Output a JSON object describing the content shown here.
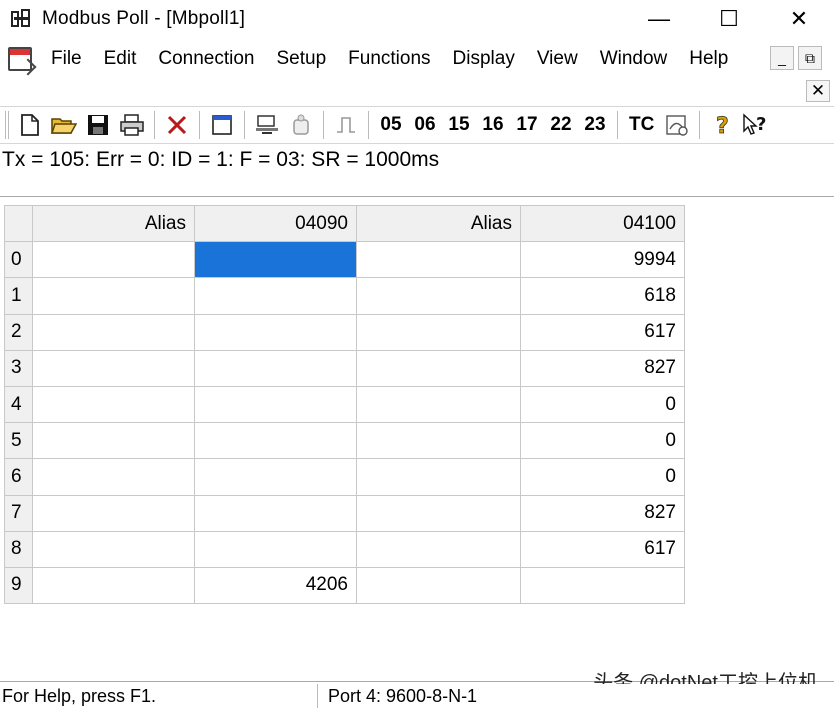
{
  "window": {
    "title": "Modbus Poll - [Mbpoll1]",
    "minimize": "—",
    "maximize": "☐",
    "close": "✕"
  },
  "menu": {
    "items": [
      "File",
      "Edit",
      "Connection",
      "Setup",
      "Functions",
      "Display",
      "View",
      "Window",
      "Help"
    ],
    "mdi_min": "_",
    "mdi_restore": "⧉",
    "mdi_close": "✕"
  },
  "toolbar": {
    "function_codes": [
      "05",
      "06",
      "15",
      "16",
      "17",
      "22",
      "23"
    ],
    "tc_label": "TC"
  },
  "status_line": "Tx = 105: Err = 0: ID = 1: F = 03: SR = 1000ms",
  "grid": {
    "headers": [
      "Alias",
      "04090",
      "Alias",
      "04100"
    ],
    "rows": [
      {
        "index": "0",
        "alias1": "",
        "v1": "",
        "alias2": "",
        "v2": "9994"
      },
      {
        "index": "1",
        "alias1": "",
        "v1": "",
        "alias2": "",
        "v2": "618"
      },
      {
        "index": "2",
        "alias1": "",
        "v1": "",
        "alias2": "",
        "v2": "617"
      },
      {
        "index": "3",
        "alias1": "",
        "v1": "",
        "alias2": "",
        "v2": "827"
      },
      {
        "index": "4",
        "alias1": "",
        "v1": "",
        "alias2": "",
        "v2": "0"
      },
      {
        "index": "5",
        "alias1": "",
        "v1": "",
        "alias2": "",
        "v2": "0"
      },
      {
        "index": "6",
        "alias1": "",
        "v1": "",
        "alias2": "",
        "v2": "0"
      },
      {
        "index": "7",
        "alias1": "",
        "v1": "",
        "alias2": "",
        "v2": "827"
      },
      {
        "index": "8",
        "alias1": "",
        "v1": "",
        "alias2": "",
        "v2": "617"
      },
      {
        "index": "9",
        "alias1": "",
        "v1": "4206",
        "alias2": "",
        "v2": ""
      }
    ],
    "selection_color": "#1a73d9"
  },
  "statusbar": {
    "help": "For Help, press F1.",
    "port": "Port 4: 9600-8-N-1"
  },
  "watermark": "头条 @dotNet工控上位机"
}
